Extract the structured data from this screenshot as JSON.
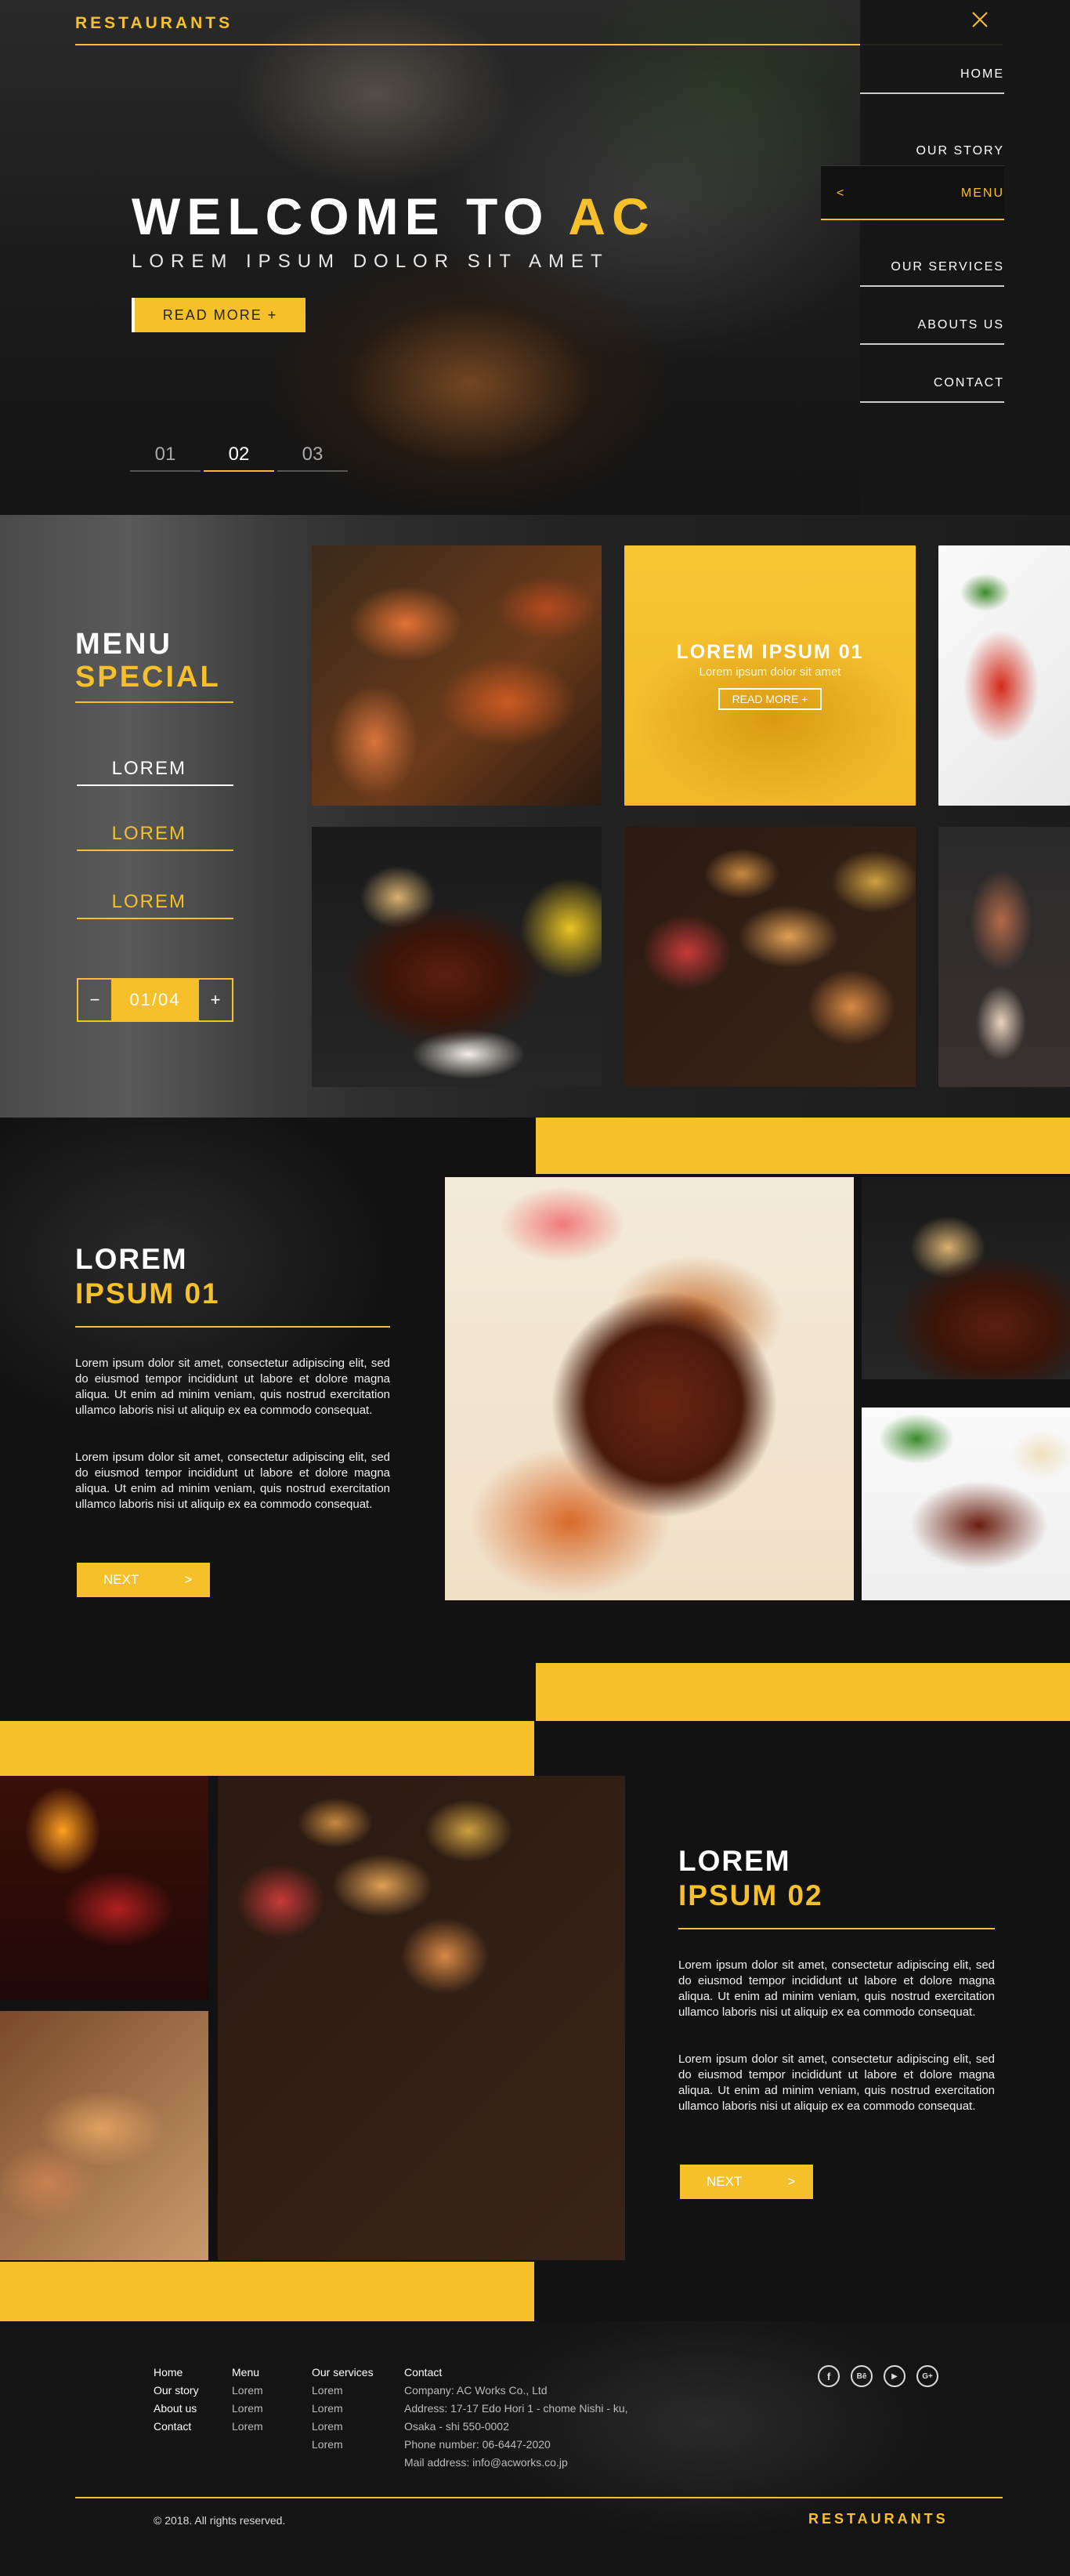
{
  "header": {
    "brand": "RESTAURANTS",
    "title_part1": "WELCOME TO ",
    "title_part2": "AC",
    "subtitle": "LOREM IPSUM DOLOR SIT AMET",
    "read_more": "READ MORE  +",
    "slides": [
      "01",
      "02",
      "03"
    ],
    "active_slide": "02",
    "close_icon": "close-icon"
  },
  "nav": {
    "items": [
      "HOME",
      "OUR STORY",
      "MENU",
      "OUR SERVICES",
      "ABOUTS US",
      "CONTACT"
    ],
    "active": "MENU",
    "back_arrow": "<"
  },
  "menu_section": {
    "heading1": "MENU",
    "heading2": "SPECIAL",
    "items": [
      "LOREM",
      "LOREM",
      "LOREM"
    ],
    "pager": {
      "minus": "−",
      "value": "01/04",
      "plus": "+"
    },
    "featured": {
      "title": "LOREM IPSUM 01",
      "subtitle": "Lorem ipsum dolor sit amet",
      "button": "READ MORE  +"
    }
  },
  "section1": {
    "heading1": "LOREM",
    "heading2": "IPSUM 01",
    "paragraphs": [
      "Lorem ipsum dolor sit amet, consectetur adipiscing elit, sed do eiusmod tempor incididunt ut labore et dolore magna aliqua. Ut enim ad minim veniam, quis nostrud exercitation ullamco laboris nisi ut aliquip ex ea commodo consequat.",
      "Lorem ipsum dolor sit amet, consectetur adipiscing elit, sed do eiusmod tempor incididunt ut labore et dolore magna aliqua. Ut enim ad minim veniam, quis nostrud exercitation ullamco laboris nisi ut aliquip ex ea commodo consequat."
    ],
    "next": "NEXT",
    "next_arrow": ">"
  },
  "section2": {
    "heading1": "LOREM",
    "heading2": "IPSUM 02",
    "paragraphs": [
      "Lorem ipsum dolor sit amet, consectetur adipiscing elit, sed do eiusmod tempor incididunt ut labore et dolore magna aliqua. Ut enim ad minim veniam, quis nostrud exercitation ullamco laboris nisi ut aliquip ex ea commodo consequat.",
      "Lorem ipsum dolor sit amet, consectetur adipiscing elit, sed do eiusmod tempor incididunt ut labore et dolore magna aliqua. Ut enim ad minim veniam, quis nostrud exercitation ullamco laboris nisi ut aliquip ex ea commodo consequat."
    ],
    "next": "NEXT",
    "next_arrow": ">"
  },
  "footer": {
    "col1": [
      "Home",
      "Our story",
      "About us",
      "Contact"
    ],
    "col2_head": "Menu",
    "col2": [
      "Lorem",
      "Lorem",
      "Lorem"
    ],
    "col3_head": "Our services",
    "col3": [
      "Lorem",
      "Lorem",
      "Lorem",
      "Lorem"
    ],
    "col4_head": "Contact",
    "col4": [
      "Company: AC Works Co., Ltd",
      "Address: 17-17 Edo Hori 1 - chome Nishi - ku,",
      "Osaka - shi 550-0002",
      "Phone number: 06-6447-2020",
      "Mail address: info@acworks.co.jp"
    ],
    "social": [
      "f",
      "Bē",
      "▶",
      "G+"
    ],
    "copyright": "© 2018. All rights reserved.",
    "brand": "RESTAURANTS"
  },
  "colors": {
    "accent": "#f5c02a",
    "bg": "#121212"
  }
}
